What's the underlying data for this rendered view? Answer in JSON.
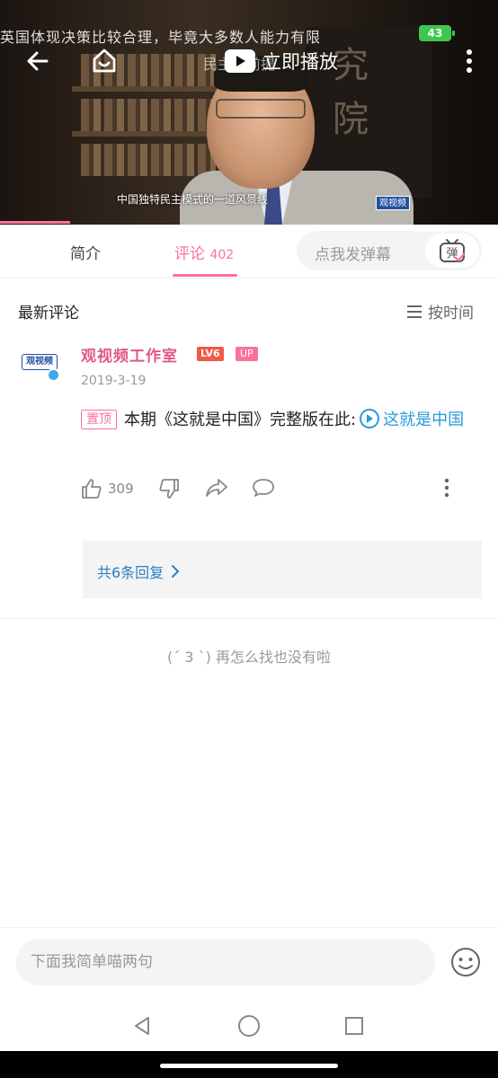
{
  "video": {
    "scroll_text_1": "英国体现决策比较合理，毕竟大多数人能力有限",
    "scroll_text_2": "民主的前提",
    "play_now_label": "立即播放",
    "subtitle": "中国独特民主模式的一道风景线",
    "channel_logo": "观视频",
    "progress_fraction": 0.14
  },
  "status": {
    "battery": "43"
  },
  "tabs": {
    "intro": "简介",
    "comments": "评论",
    "comment_count": "402",
    "danmaku_placeholder": "点我发弹幕",
    "danmaku_icon_char": "弹"
  },
  "comments_header": {
    "title": "最新评论",
    "sort_label": "按时间"
  },
  "comment": {
    "avatar_text": "观视频",
    "username": "观视频工作室",
    "level": "LV6",
    "up_badge": "UP",
    "date": "2019-3-19",
    "pin_label": "置顶",
    "text": "本期《这就是中国》完整版在此:",
    "video_link": "这就是中国",
    "likes": "309",
    "replies_label": "共6条回复"
  },
  "end_text": "(ˊ 3 ˋ)  再怎么找也没有啦",
  "input": {
    "placeholder": "下面我简单喵两句"
  },
  "colors": {
    "accent": "#fb7299",
    "link": "#2a9bd8",
    "level": "#f15a47"
  }
}
